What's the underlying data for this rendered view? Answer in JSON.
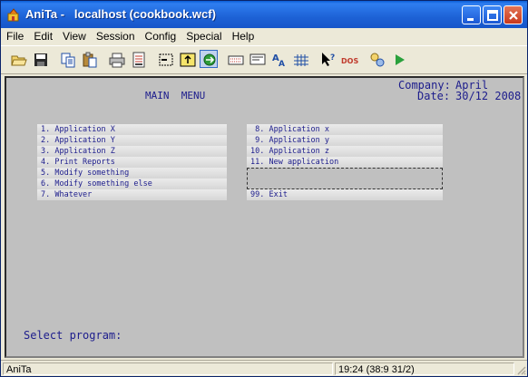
{
  "window": {
    "title": "AniTa -   localhost (cookbook.wcf)"
  },
  "menubar": {
    "items": [
      "File",
      "Edit",
      "View",
      "Session",
      "Config",
      "Special",
      "Help"
    ]
  },
  "toolbar": {
    "icons": [
      "open-folder-icon",
      "save-icon",
      "copy-icon",
      "paste-icon",
      "print-icon",
      "print-setup-icon",
      "select-icon",
      "pin-icon",
      "connect-icon",
      "keyboard-icon",
      "screen-icon",
      "font-icon",
      "grid-icon",
      "help-cursor-icon",
      "dos-icon",
      "macro-icon",
      "run-icon"
    ]
  },
  "terminal": {
    "company_label": "Company:",
    "company_value": "April",
    "date_label": "Date:",
    "date_value": "30/12 2008",
    "menu_title": "MAIN  MENU",
    "left_options": [
      "1. Application X",
      "2. Application Y",
      "3. Application Z",
      "4. Print Reports",
      "5. Modify something",
      "6. Modify something else",
      "7. Whatever"
    ],
    "right_options": [
      " 8. Application x",
      " 9. Application y",
      "10. Application z",
      "11. New application",
      "",
      "99. Exit"
    ],
    "prompt": "Select program:"
  },
  "statusbar": {
    "app": "AniTa",
    "position": "19:24 (38:9 31/2)"
  },
  "colors": {
    "terminal_bg": "#c0c0c0",
    "terminal_text": "#1c1c8c",
    "titlebar": "#1d62d6"
  }
}
